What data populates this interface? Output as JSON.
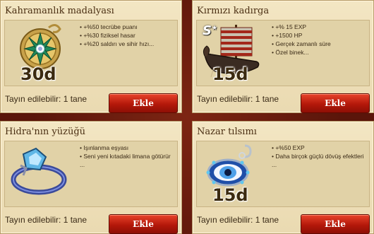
{
  "cards": [
    {
      "title": "Kahramanlık madalyası",
      "icon": "medal-icon",
      "duration": "30d",
      "effects": [
        "+%50 tecrübe puanı",
        "+%30 fiziksel hasar",
        "+%20 saldırı ve sihir hızı..."
      ],
      "assignable": "Tayın edilebilir: 1 tane",
      "button": "Ekle"
    },
    {
      "title": "Kırmızı kadırga",
      "icon": "ship-icon",
      "rank": "S",
      "duration": "15d",
      "effects": [
        "+% 15 EXP",
        "+1500 HP",
        "Gerçek zamanlı süre",
        "Özel binek..."
      ],
      "assignable": "Tayın edilebilir: 1 tane",
      "button": "Ekle"
    },
    {
      "title": "Hidra'nın yüzüğü",
      "icon": "ring-icon",
      "effects": [
        "Işınlanma eşyası",
        "Seni yeni kıtadaki limana götürür",
        "..."
      ],
      "assignable": "Tayın edilebilir: 1 tane",
      "button": "Ekle"
    },
    {
      "title": "Nazar tılsımı",
      "icon": "amulet-icon",
      "duration": "15d",
      "effects": [
        "+%50 EXP",
        "Daha birçok güçlü dövüş efektleri",
        "..."
      ],
      "assignable": "Tayın edilebilir: 1 tane",
      "button": "Ekle"
    }
  ]
}
